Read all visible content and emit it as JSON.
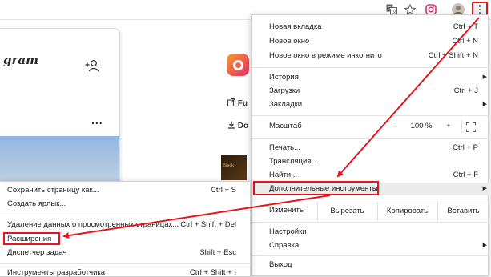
{
  "toolbar": {
    "icons": [
      "translate-icon",
      "star-icon",
      "instagram-extension-icon",
      "profile-avatar-icon",
      "menu-icon"
    ]
  },
  "page": {
    "ig_logo": "gram",
    "ig_more": "...",
    "link1": "Fu",
    "link2": "Do",
    "thumb_text": "Black"
  },
  "menu": {
    "new_tab": {
      "label": "Новая вкладка",
      "shortcut": "Ctrl + T"
    },
    "new_window": {
      "label": "Новое окно",
      "shortcut": "Ctrl + N"
    },
    "incognito": {
      "label": "Новое окно в режиме инкогнито",
      "shortcut": "Ctrl + Shift + N"
    },
    "history": {
      "label": "История"
    },
    "downloads": {
      "label": "Загрузки",
      "shortcut": "Ctrl + J"
    },
    "bookmarks": {
      "label": "Закладки"
    },
    "zoom": {
      "label": "Масштаб",
      "minus": "–",
      "value": "100 %",
      "plus": "+"
    },
    "print": {
      "label": "Печать...",
      "shortcut": "Ctrl + P"
    },
    "cast": {
      "label": "Трансляция..."
    },
    "find": {
      "label": "Найти...",
      "shortcut": "Ctrl + F"
    },
    "more_tools": {
      "label": "Дополнительные инструменты"
    },
    "edit": {
      "label": "Изменить",
      "cut": "Вырезать",
      "copy": "Копировать",
      "paste": "Вставить"
    },
    "settings": {
      "label": "Настройки"
    },
    "help": {
      "label": "Справка"
    },
    "exit": {
      "label": "Выход"
    }
  },
  "submenu": {
    "save_page": {
      "label": "Сохранить страницу как...",
      "shortcut": "Ctrl + S"
    },
    "create_shortcut": {
      "label": "Создать ярлык..."
    },
    "clear_data": {
      "label": "Удаление данных о просмотренных страницах...",
      "shortcut": "Ctrl + Shift + Del"
    },
    "extensions": {
      "label": "Расширения"
    },
    "task_manager": {
      "label": "Диспетчер задач",
      "shortcut": "Shift + Esc"
    },
    "dev_tools": {
      "label": "Инструменты разработчика",
      "shortcut": "Ctrl + Shift + I"
    }
  },
  "colors": {
    "annotation_red": "#e6141b",
    "menu_highlight": "#ebebeb"
  }
}
